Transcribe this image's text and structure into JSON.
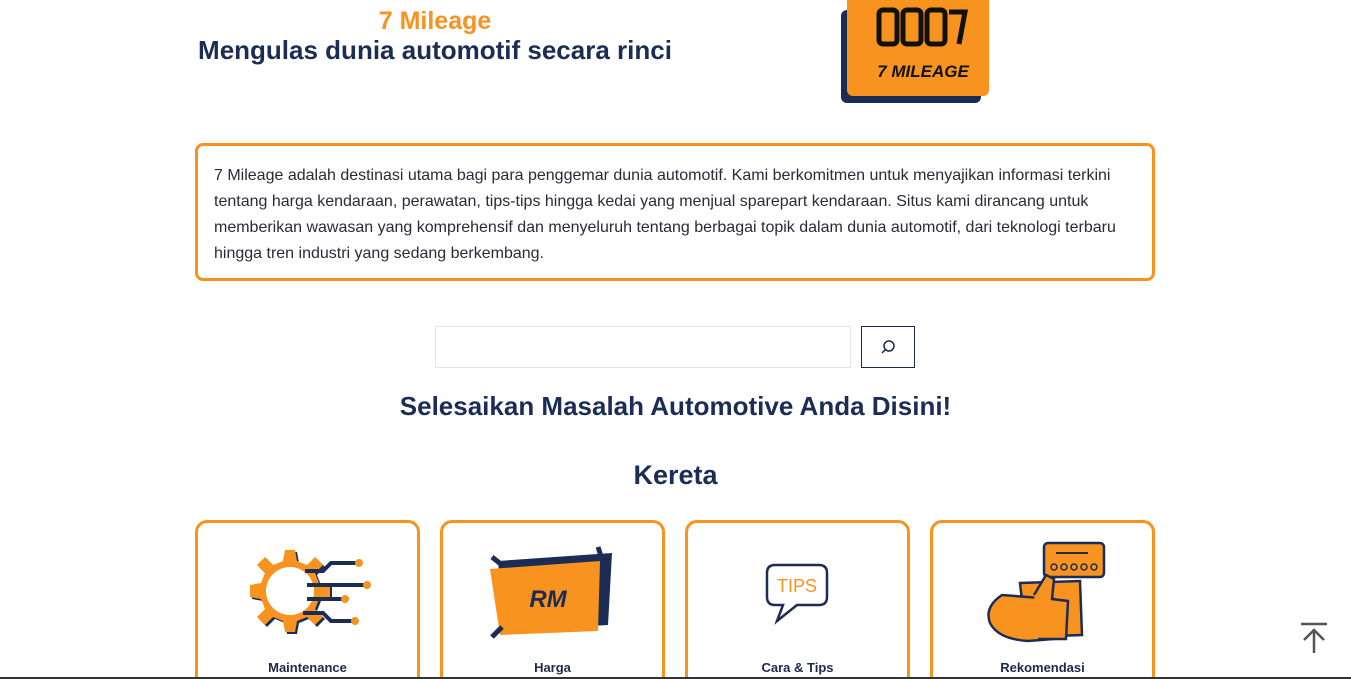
{
  "hero": {
    "brand": "7 Mileage",
    "tagline": "Mengulas dunia automotif secara rinci",
    "logo_text": "7 MILEAGE",
    "logo_odometer": "0007"
  },
  "about": {
    "text": "7 Mileage adalah destinasi utama bagi para penggemar dunia automotif. Kami berkomitmen untuk menyajikan informasi terkini tentang harga kendaraan, perawatan, tips-tips hingga kedai yang menjual sparepart kendaraan. Situs kami dirancang untuk memberikan wawasan yang komprehensif dan menyeluruh tentang berbagai topik dalam dunia automotif, dari teknologi terbaru hingga tren industri yang sedang berkembang."
  },
  "search": {
    "value": "",
    "placeholder": "",
    "button_icon": "search-icon"
  },
  "headings": {
    "main": "Selesaikan Masalah Automotive Anda Disini!",
    "category": "Kereta"
  },
  "cards": [
    {
      "label": "Maintenance",
      "icon": "gear-circuit-icon"
    },
    {
      "label": "Harga",
      "icon": "price-tag-icon",
      "icon_text": "RM"
    },
    {
      "label": "Cara & Tips",
      "icon": "tips-bubble-icon",
      "icon_text": "TIPS"
    },
    {
      "label": "Rekomendasi",
      "icon": "thumbs-up-review-icon"
    }
  ],
  "colors": {
    "accent": "#f7931e",
    "navy": "#1c2d55"
  }
}
